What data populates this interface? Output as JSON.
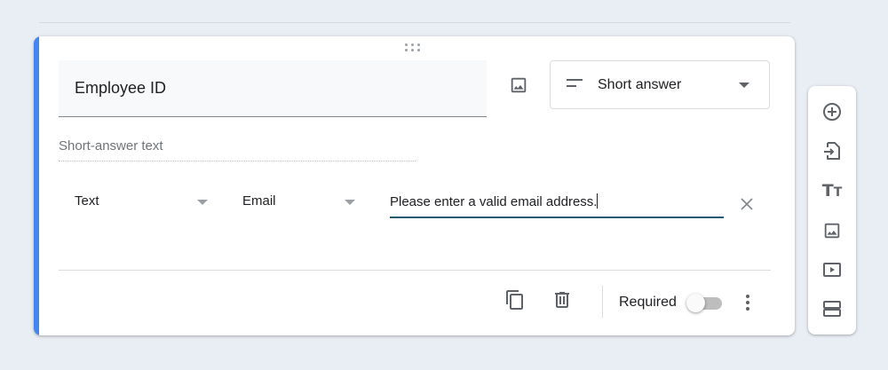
{
  "question": {
    "title": "Employee ID",
    "type_label": "Short answer",
    "answer_placeholder": "Short-answer text"
  },
  "validation": {
    "type_value": "Text",
    "condition_value": "Email",
    "error_text": "Please enter a valid email address."
  },
  "footer": {
    "required_label": "Required",
    "required_on": false
  },
  "colors": {
    "accent": "#4285f4",
    "input_underline_active": "#1a5b73",
    "icon": "#5f6368"
  },
  "icons": {
    "drag": "drag-handle-icon",
    "image": "image-icon",
    "short_answer": "short-text-icon",
    "clear": "close-icon",
    "copy": "copy-icon",
    "delete": "trash-icon",
    "more": "more-vert-icon"
  },
  "side_toolbar": {
    "items": [
      "add-question-icon",
      "import-questions-icon",
      "add-title-icon",
      "add-image-icon",
      "add-video-icon",
      "add-section-icon"
    ]
  }
}
